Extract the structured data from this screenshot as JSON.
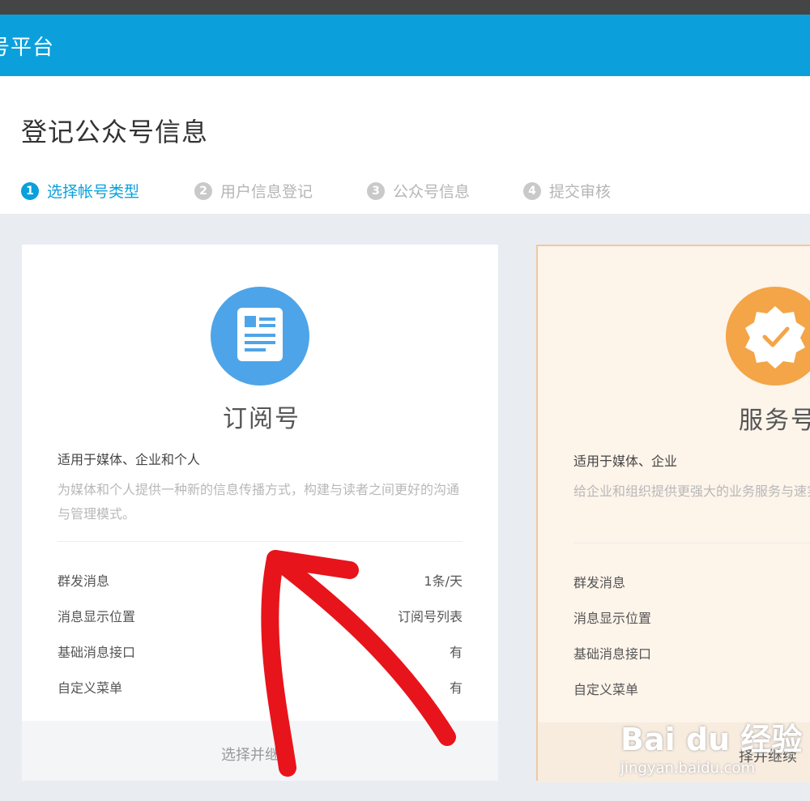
{
  "header": {
    "title": "号平台"
  },
  "page": {
    "title": "登记公众号信息"
  },
  "steps": [
    {
      "num": "1",
      "label": "选择帐号类型",
      "active": true
    },
    {
      "num": "2",
      "label": "用户信息登记",
      "active": false
    },
    {
      "num": "3",
      "label": "公众号信息",
      "active": false
    },
    {
      "num": "4",
      "label": "提交审核",
      "active": false
    }
  ],
  "cards": [
    {
      "icon": "document-icon",
      "name": "订阅号",
      "suit": "适用于媒体、企业和个人",
      "desc": "为媒体和个人提供一种新的信息传播方式，构建与读者之间更好的沟通与管理模式。",
      "features": [
        {
          "label": "群发消息",
          "value": "1条/天"
        },
        {
          "label": "消息显示位置",
          "value": "订阅号列表"
        },
        {
          "label": "基础消息接口",
          "value": "有"
        },
        {
          "label": "自定义菜单",
          "value": "有"
        }
      ],
      "button": "选择并继续",
      "color": "#4ea4e8"
    },
    {
      "icon": "verified-badge-icon",
      "name": "服务号",
      "suit": "适用于媒体、企业",
      "desc": "给企业和组织提供更强大的业务服务与速实现全新的公众号服务平台。",
      "features": [
        {
          "label": "群发消息"
        },
        {
          "label": "消息显示位置"
        },
        {
          "label": "基础消息接口"
        },
        {
          "label": "自定义菜单"
        }
      ],
      "button": "择并继续",
      "color": "#f3a547"
    }
  ],
  "watermark": {
    "main": "Bai du 经验",
    "url": "jingyan.baidu.com"
  },
  "annotation": {
    "arrow_color": "#e8141b"
  },
  "theme": {
    "header_bg": "#0ba0dc",
    "accent": "#0ba0dc",
    "page_bg": "#e9edf1"
  }
}
